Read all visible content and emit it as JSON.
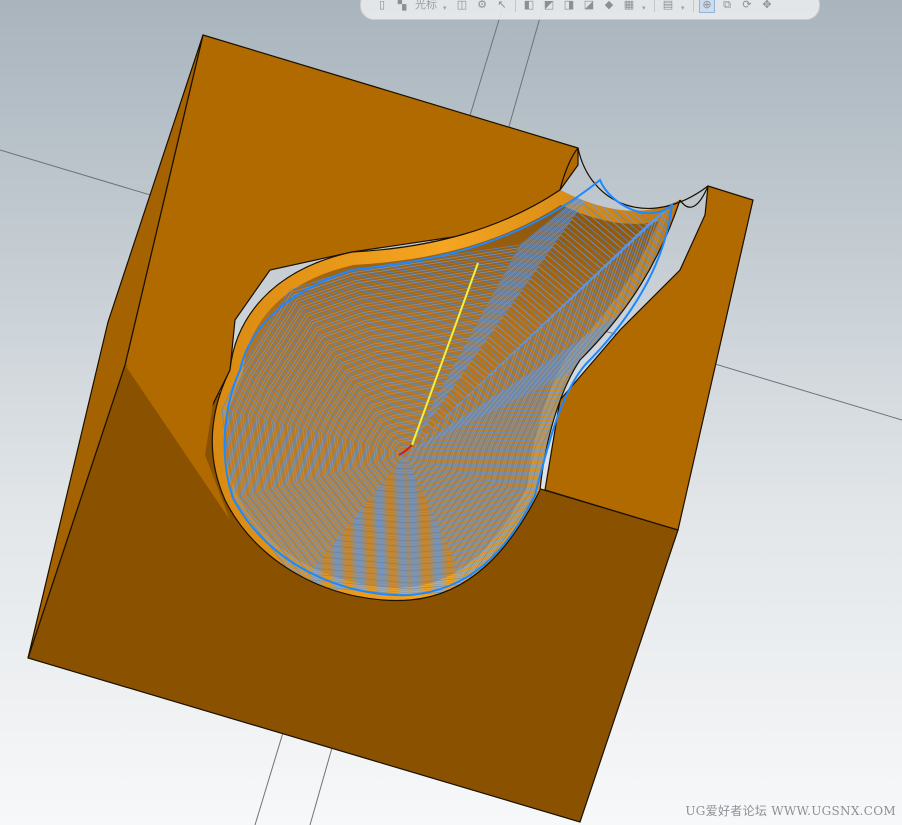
{
  "toolbar": {
    "selection_label": "光标",
    "buttons": [
      {
        "name": "save-icon",
        "glyph": "▯"
      },
      {
        "name": "select-filter-icon",
        "glyph": "▚"
      },
      {
        "name": "snap-point-icon",
        "glyph": "◫"
      },
      {
        "name": "gear-icon",
        "glyph": "⚙"
      },
      {
        "name": "arrow-cursor-icon",
        "glyph": "↖"
      },
      {
        "name": "view-front-icon",
        "glyph": "◧"
      },
      {
        "name": "view-top-icon",
        "glyph": "◩"
      },
      {
        "name": "view-right-icon",
        "glyph": "◨"
      },
      {
        "name": "view-iso-icon",
        "glyph": "◪"
      },
      {
        "name": "render-shaded-icon",
        "glyph": "◆"
      },
      {
        "name": "layer-icon",
        "glyph": "▦"
      },
      {
        "name": "grid-icon",
        "glyph": "▤"
      },
      {
        "name": "zoom-icon",
        "glyph": "⊕"
      },
      {
        "name": "fit-view-icon",
        "glyph": "⧉"
      },
      {
        "name": "rotate-icon",
        "glyph": "⟳"
      },
      {
        "name": "pan-icon",
        "glyph": "✥"
      }
    ]
  },
  "viewport": {
    "part_color_front": "#8a5200",
    "part_color_top": "#b06a00",
    "toolpath_color": "#1e88ff",
    "tool_axis_color": "#f2f23a"
  },
  "watermark": "UG爱好者论坛 WWW.UGSNX.COM"
}
